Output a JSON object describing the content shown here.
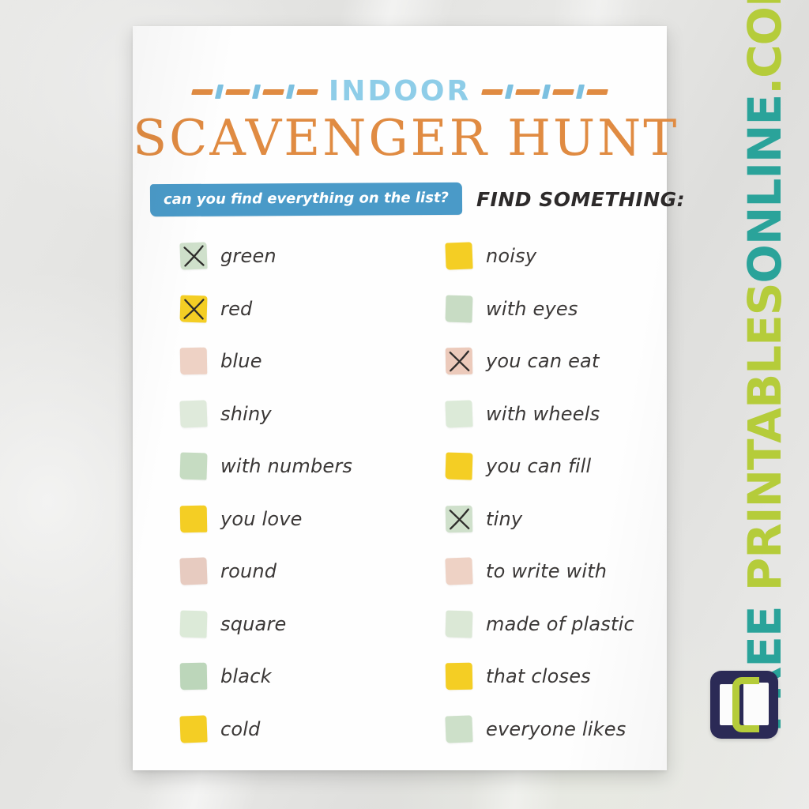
{
  "page": {
    "title_top": "INDOOR",
    "title_main": "SCAVENGER HUNT",
    "tagline": "can you find everything on the list?",
    "find_label": "FIND SOMETHING:"
  },
  "colors": {
    "orange": "#e08b42",
    "light_blue": "#8ecde8",
    "banner_blue": "#4a9ac8",
    "box_green": "#cfe0cb",
    "box_green_deep": "#b9d3b7",
    "box_yellow": "#f4ce24",
    "box_pink": "#eed2c5",
    "ink": "#3a3736",
    "teal": "#2aa39a",
    "lime": "#b5cc3a",
    "logo_navy": "#2b2a56"
  },
  "checklist": {
    "left": [
      {
        "label": "green",
        "box_color": "#cfe0cb",
        "checked": true
      },
      {
        "label": "red",
        "box_color": "#f4ce24",
        "checked": true
      },
      {
        "label": "blue",
        "box_color": "#eed2c5",
        "checked": false
      },
      {
        "label": "shiny",
        "box_color": "#dfeadb",
        "checked": false
      },
      {
        "label": "with numbers",
        "box_color": "#c6dcc2",
        "checked": false
      },
      {
        "label": "you love",
        "box_color": "#f4ce24",
        "checked": false
      },
      {
        "label": "round",
        "box_color": "#e7cbc0",
        "checked": false
      },
      {
        "label": "square",
        "box_color": "#dcead8",
        "checked": false
      },
      {
        "label": "black",
        "box_color": "#bcd6ba",
        "checked": false
      },
      {
        "label": "cold",
        "box_color": "#f4ce24",
        "checked": false
      }
    ],
    "right": [
      {
        "label": "noisy",
        "box_color": "#f4ce24",
        "checked": false
      },
      {
        "label": "with eyes",
        "box_color": "#c8dcc4",
        "checked": false
      },
      {
        "label": "you can eat",
        "box_color": "#eccabb",
        "checked": true
      },
      {
        "label": "with wheels",
        "box_color": "#dcead8",
        "checked": false
      },
      {
        "label": "you can fill",
        "box_color": "#f4ce24",
        "checked": false
      },
      {
        "label": "tiny",
        "box_color": "#cfe0cb",
        "checked": true
      },
      {
        "label": "to write with",
        "box_color": "#eed2c5",
        "checked": false
      },
      {
        "label": "made of plastic",
        "box_color": "#dbe8d6",
        "checked": false
      },
      {
        "label": "that closes",
        "box_color": "#f4ce24",
        "checked": false
      },
      {
        "label": "everyone likes",
        "box_color": "#cde0c9",
        "checked": false
      }
    ]
  },
  "watermark": {
    "part1": "FREE ",
    "part2": "PRINTABLES",
    "part3": "ONLINE",
    "part4": ".COM",
    "logo_name": "free-printables-online-logo"
  }
}
